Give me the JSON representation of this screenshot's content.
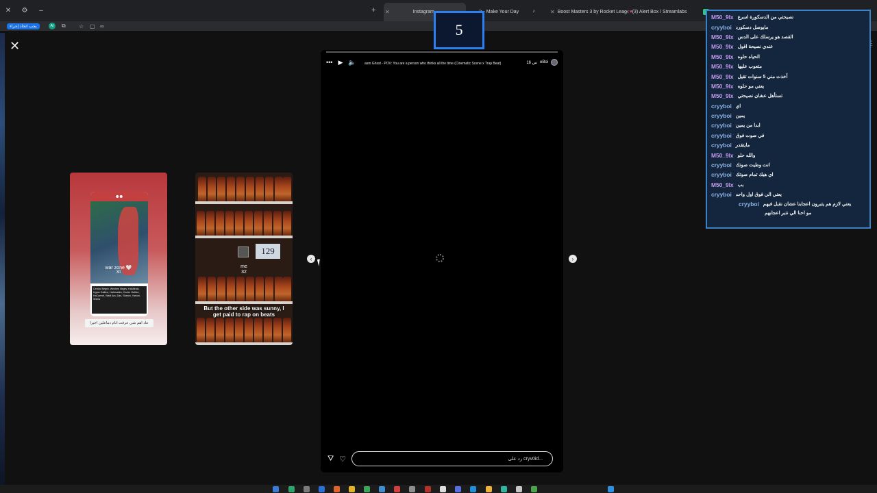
{
  "browser": {
    "tabs": [
      {
        "label": "Instagram"
      },
      {
        "label": "k - Make Your Day"
      },
      {
        "label": "Boost Masters 3 by Rocket Leag"
      },
      {
        "label": "(3) Alert Box / Streamlabs"
      }
    ],
    "toolbar_chip": "يجب اتخاذ إجراء",
    "avatar_letter": "AI"
  },
  "story": {
    "username": "eBoi",
    "time": "16 س",
    "music": "asm Ghxst - POV: You are a person who thinks all the time (Cinematic Scene x Trap Beat)",
    "reply_placeholder": "رد على cryv0id..."
  },
  "preview_one": {
    "warzone_text": "war zone",
    "warzone_sub": "30",
    "info_text": "Central Negev, Western Negev, HaMifratz, Upper Galilee, HaAmakim, Center Galilee, HaCarmel, Wadi Ara, Dan, Sharon, Yarkon, Shfela",
    "caption": "عاد اهم شي عرفت اتام دماعلين اخيرا"
  },
  "preview_two": {
    "price": "129",
    "me_label": "me",
    "me_sub": "32",
    "quote": "But the other side was sunny, I get paid to rap on beats"
  },
  "timer": {
    "value": "5"
  },
  "chat": {
    "messages": [
      {
        "user": "M50_9lx",
        "text": "نصيحتي من الدسكورة اسرع",
        "kind": "m50"
      },
      {
        "user": "cryyboi",
        "text": "مايوصل دسكورد",
        "kind": "cry"
      },
      {
        "user": "M50_9lx",
        "text": "القصد هو يرسلك على الدس",
        "kind": "m50"
      },
      {
        "user": "M50_9lx",
        "text": "عندي نصيحة اقول",
        "kind": "m50"
      },
      {
        "user": "M50_9lx",
        "text": "الحياه حلوه",
        "kind": "m50"
      },
      {
        "user": "M50_9lx",
        "text": "متعوب عليها",
        "kind": "m50"
      },
      {
        "user": "M50_9lx",
        "text": "أخذت مني 5 سنوات تقيل",
        "kind": "m50"
      },
      {
        "user": "M50_9lx",
        "text": "يعني مو حلوه",
        "kind": "m50"
      },
      {
        "user": "M50_9lx",
        "text": "تستأهل عشان نصيحتي",
        "kind": "m50"
      },
      {
        "user": "cryyboi",
        "text": "اي",
        "kind": "cry"
      },
      {
        "user": "cryyboi",
        "text": "يمين",
        "kind": "cry"
      },
      {
        "user": "cryyboi",
        "text": "ابدا من يمين",
        "kind": "cry"
      },
      {
        "user": "cryyboi",
        "text": "في صوت فوق",
        "kind": "cry"
      },
      {
        "user": "cryyboi",
        "text": "مايتقدر",
        "kind": "cry"
      },
      {
        "user": "M50_9lx",
        "text": "والله حلو",
        "kind": "m50"
      },
      {
        "user": "cryyboi",
        "text": "انت وطيت صوتك",
        "kind": "cry"
      },
      {
        "user": "cryyboi",
        "text": "اي هيك تمام صوتك",
        "kind": "cry"
      },
      {
        "user": "M50_9lx",
        "text": "بب",
        "kind": "m50"
      },
      {
        "user": "cryyboi",
        "text": "يعني الي فوق اول واحد",
        "kind": "cry"
      }
    ],
    "last_user": "cryyboi",
    "last_line1": "يعني لازم هم يتبرون اعجابنا عشان نقبل فيهم",
    "last_line2": "مو احنا الي نتبر اعجابهم"
  },
  "colors": {
    "chat_bg": "#13263e",
    "chat_border": "#3a83c8",
    "timer_border": "#2e7ff0",
    "user_m50": "#c79bef",
    "user_cry": "#8fb4e8"
  },
  "icons": [
    "close-icon",
    "more-icon",
    "play-icon",
    "volume-icon",
    "chevron-left-icon",
    "chevron-right-icon",
    "send-icon",
    "heart-icon"
  ]
}
